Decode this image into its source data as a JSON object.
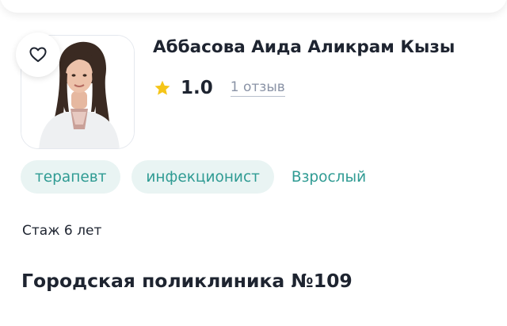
{
  "doctor": {
    "name": "Аббасова Аида Аликрам Кызы",
    "rating": "1.0",
    "reviews": "1 отзыв",
    "photo_alt": "doctor-portrait"
  },
  "tags": [
    "терапевт",
    "инфекционист",
    "Взрослый"
  ],
  "experience": "Стаж 6 лет",
  "clinic": "Городская поликлиника №109",
  "colors": {
    "accent_teal": "#2f9b93",
    "tag_background": "#e9f4f3",
    "star": "#f5c518",
    "text": "#1e2430",
    "muted": "#8a93a6"
  },
  "icons": {
    "favorite": "heart-outline-icon",
    "rating": "star-icon"
  }
}
